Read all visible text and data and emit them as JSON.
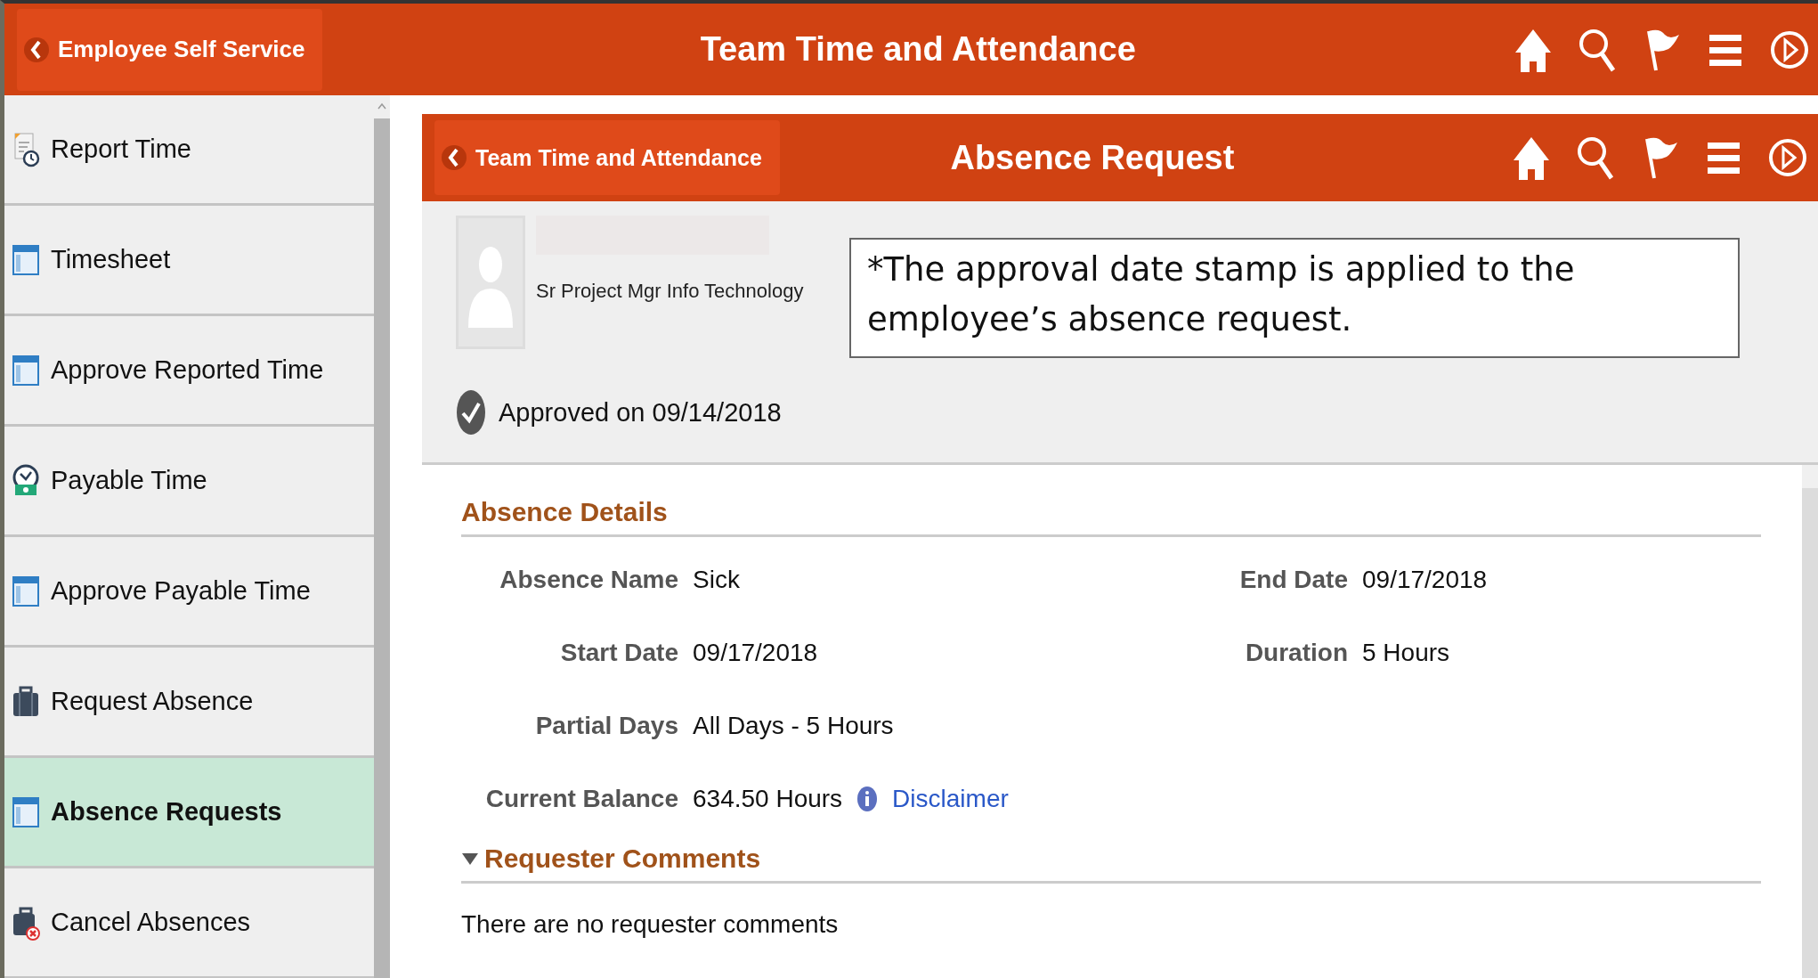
{
  "top_bar": {
    "back_label": "Employee Self Service",
    "title": "Team Time and Attendance"
  },
  "sidebar": {
    "items": [
      {
        "label": "Report Time",
        "kind": "report",
        "selected": false
      },
      {
        "label": "Timesheet",
        "kind": "form",
        "selected": false
      },
      {
        "label": "Approve Reported Time",
        "kind": "form",
        "selected": false
      },
      {
        "label": "Payable Time",
        "kind": "clock",
        "selected": false
      },
      {
        "label": "Approve Payable Time",
        "kind": "form",
        "selected": false
      },
      {
        "label": "Request Absence",
        "kind": "case",
        "selected": false
      },
      {
        "label": "Absence Requests",
        "kind": "form",
        "selected": true
      },
      {
        "label": "Cancel Absences",
        "kind": "case-cancel",
        "selected": false
      }
    ]
  },
  "page_header": {
    "back_label": "Team Time and Attendance",
    "title": "Absence Request"
  },
  "employee": {
    "job_title": "Sr Project Mgr Info Technology"
  },
  "callout": "*The approval date stamp is applied to the employee’s absence request.",
  "status": {
    "text": "Approved on 09/14/2018",
    "approved": true
  },
  "absence_details": {
    "heading": "Absence Details",
    "rows": [
      [
        {
          "label": "Absence Name",
          "value": "Sick"
        },
        {
          "label": "End Date",
          "value": "09/17/2018"
        }
      ],
      [
        {
          "label": "Start Date",
          "value": "09/17/2018"
        },
        {
          "label": "Duration",
          "value": "5 Hours"
        }
      ],
      [
        {
          "label": "Partial Days",
          "value": "All Days - 5 Hours"
        }
      ],
      [
        {
          "label": "Current Balance",
          "value": "634.50 Hours",
          "link": "Disclaimer"
        }
      ]
    ]
  },
  "requester_comments": {
    "heading": "Requester Comments",
    "expanded": true,
    "text": "There are no requester comments"
  }
}
